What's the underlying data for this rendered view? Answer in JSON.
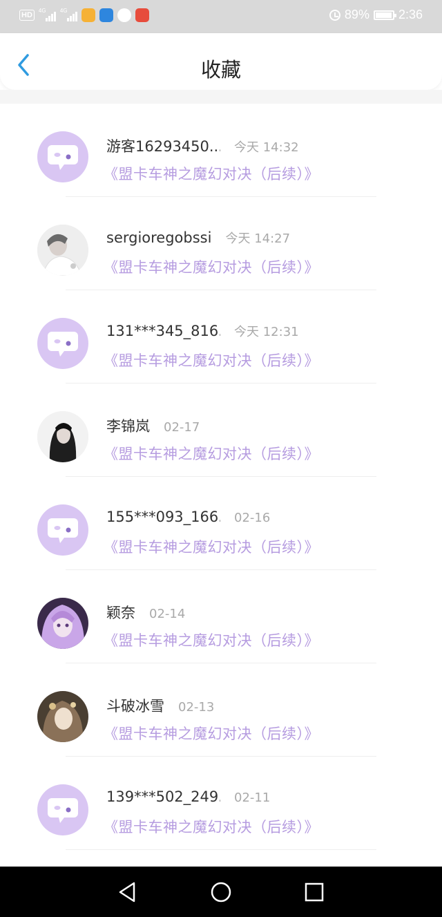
{
  "status_bar": {
    "hd_label": "HD",
    "network_1": "4G",
    "network_2": "4G",
    "battery": "89%",
    "time": "2:36"
  },
  "header": {
    "title": "收藏"
  },
  "items": [
    {
      "name": "游客16293450...",
      "time": "今天 14:32",
      "title": "《盟卡车神之魔幻对决（后续）》",
      "avatar": "default"
    },
    {
      "name": "sergioregobssi",
      "time": "今天 14:27",
      "title": "《盟卡车神之魔幻对决（后续）》",
      "avatar": "photo"
    },
    {
      "name": "131***345_816...",
      "time": "今天 12:31",
      "title": "《盟卡车神之魔幻对决（后续）》",
      "avatar": "default"
    },
    {
      "name": "李锦岚",
      "time": "02-17",
      "title": "《盟卡车神之魔幻对决（后续）》",
      "avatar": "photo"
    },
    {
      "name": "155***093_166...",
      "time": "02-16",
      "title": "《盟卡车神之魔幻对决（后续）》",
      "avatar": "default"
    },
    {
      "name": "颖奈",
      "time": "02-14",
      "title": "《盟卡车神之魔幻对决（后续）》",
      "avatar": "photo"
    },
    {
      "name": "斗破冰雪",
      "time": "02-13",
      "title": "《盟卡车神之魔幻对决（后续）》",
      "avatar": "photo"
    },
    {
      "name": "139***502_249...",
      "time": "02-11",
      "title": "《盟卡车神之魔幻对决（后续）》",
      "avatar": "default"
    }
  ],
  "colors": {
    "accent": "#b69ce0",
    "avatar_bg": "#d9c6f3",
    "back_arrow": "#2f9be0"
  }
}
